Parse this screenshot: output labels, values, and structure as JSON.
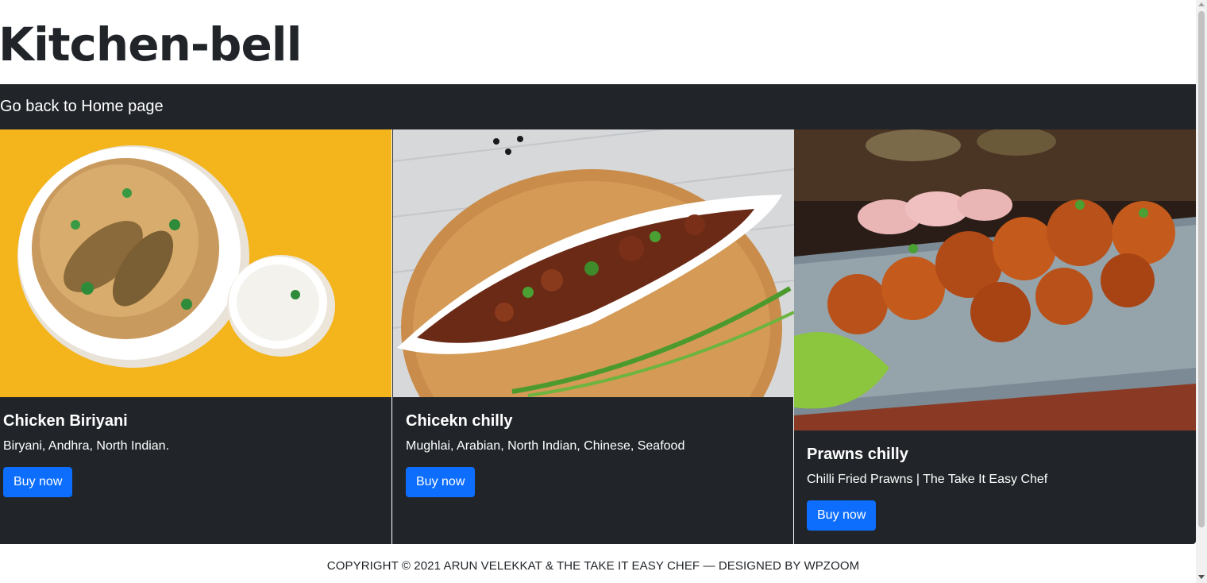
{
  "header": {
    "title": "Kitchen-bell"
  },
  "navbar": {
    "home_link": "Go back to Home page"
  },
  "cards": [
    {
      "title": "Chicken Biriyani",
      "text": "Biryani, Andhra, North Indian.",
      "button": "Buy now"
    },
    {
      "title": "Chicekn chilly",
      "text": "Mughlai, Arabian, North Indian, Chinese, Seafood",
      "button": "Buy now"
    },
    {
      "title": "Prawns chilly",
      "text": "Chilli Fried Prawns | The Take It Easy Chef",
      "button": "Buy now"
    }
  ],
  "footer": {
    "copyright": "COPYRIGHT © 2021 ARUN VELEKKAT & THE TAKE IT EASY CHEF — DESIGNED BY WPZOOM"
  },
  "colors": {
    "navbar_bg": "#212529",
    "button_bg": "#0d6efd",
    "text_dark": "#212529"
  }
}
